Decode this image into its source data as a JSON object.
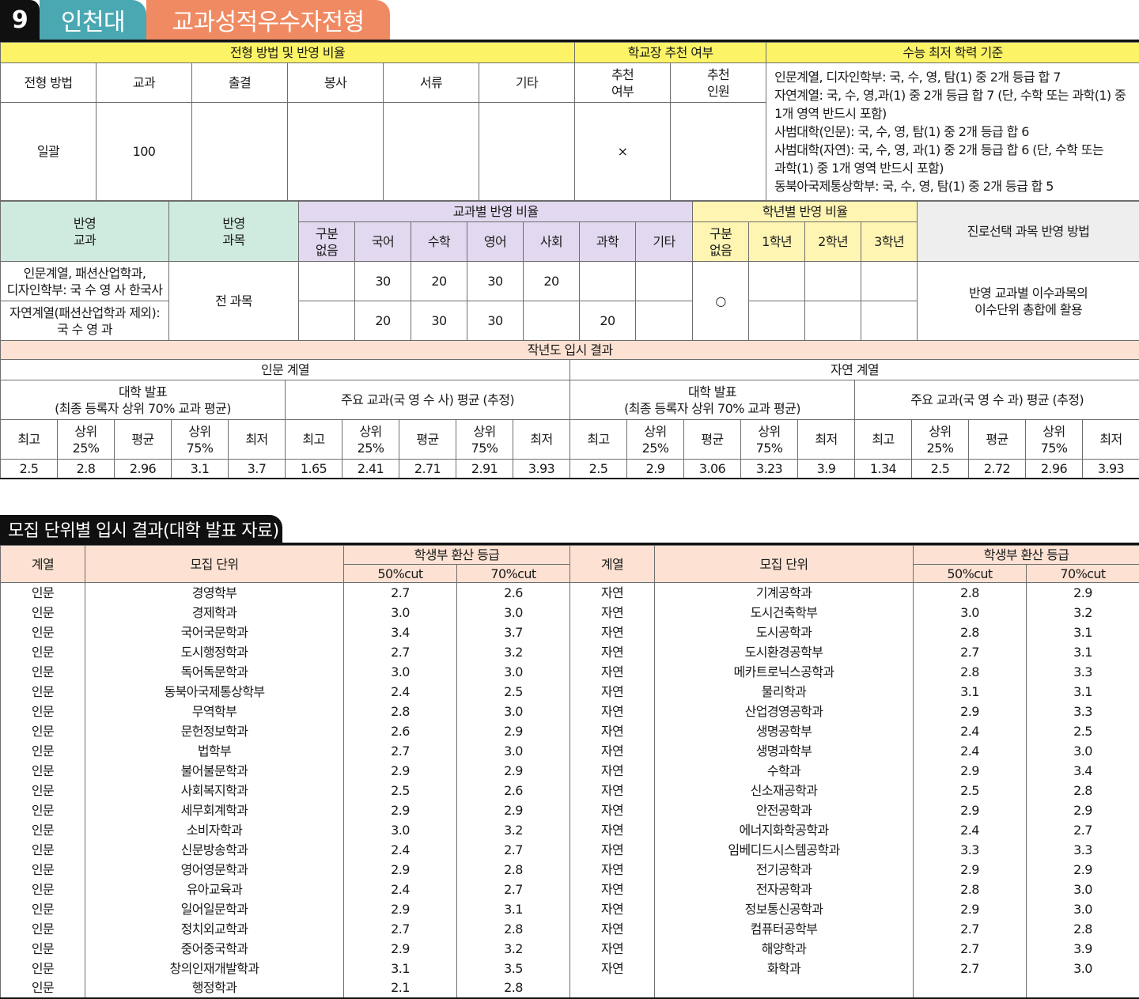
{
  "header": {
    "number": "9",
    "university": "인천대",
    "admission_type": "교과성적우수자전형"
  },
  "method_table": {
    "group_method": "전형 방법 및 반영 비율",
    "group_principal": "학교장 추천 여부",
    "group_csat": "수능 최저 학력 기준",
    "cols": [
      "전형 방법",
      "교과",
      "출결",
      "봉사",
      "서류",
      "기타"
    ],
    "principal_cols": [
      "추천\n여부",
      "추천\n인원"
    ],
    "row": [
      "일괄",
      "100",
      "",
      "",
      "",
      ""
    ],
    "principal_row": [
      "×",
      ""
    ],
    "csat_lines": [
      "인문계열, 디자인학부: 국, 수, 영, 탐(1) 중 2개 등급 합 7",
      "자연계열: 국, 수, 영,과(1) 중 2개 등급 합 7 (단, 수학 또는 과학(1) 중",
      "1개 영역 반드시 포함)",
      "사범대학(인문): 국, 수, 영, 탐(1) 중 2개 등급 합 6",
      "사범대학(자연): 국, 수, 영, 과(1) 중 2개 등급 합 6 (단, 수학 또는",
      "과학(1) 중 1개 영역 반드시 포함)",
      "동북아국제통상학부: 국, 수, 영, 탐(1) 중 2개 등급 합 5"
    ]
  },
  "reflect_table": {
    "h_subject": "반영\n교과",
    "h_courses": "반영\n과목",
    "h_subject_ratio": "교과별 반영 비율",
    "h_grade_ratio": "학년별 반영 비율",
    "h_career": "진로선택 과목 반영 방법",
    "subject_cols": [
      "구분\n없음",
      "국어",
      "수학",
      "영어",
      "사회",
      "과학",
      "기타"
    ],
    "grade_cols": [
      "구분\n없음",
      "1학년",
      "2학년",
      "3학년"
    ],
    "rows": [
      {
        "subject": "인문계열, 패션산업학과,\n디자인학부: 국 수 영 사 한국사",
        "ratios": [
          "",
          "30",
          "20",
          "30",
          "20",
          "",
          ""
        ]
      },
      {
        "subject": "자연계열(패션산업학과 제외):\n국 수 영 과",
        "ratios": [
          "",
          "20",
          "30",
          "30",
          "",
          "20",
          ""
        ]
      }
    ],
    "courses": "전 과목",
    "grade_mark": "○",
    "career_method": "반영 교과별 이수과목의\n이수단위 총합에 활용"
  },
  "last_year": {
    "title": "작년도 입시 결과",
    "humanities": "인문 계열",
    "science": "자연 계열",
    "univ_announce": "대학 발표\n(최종 등록자 상위 70% 교과 평균)",
    "main_hum": "주요 교과(국 영 수 사) 평균 (추정)",
    "main_sci": "주요 교과(국 영 수 과) 평균 (추정)",
    "stat_cols": [
      "최고",
      "상위\n25%",
      "평균",
      "상위\n75%",
      "최저"
    ],
    "values": [
      "2.5",
      "2.8",
      "2.96",
      "3.1",
      "3.7",
      "1.65",
      "2.41",
      "2.71",
      "2.91",
      "3.93",
      "2.5",
      "2.9",
      "3.06",
      "3.23",
      "3.9",
      "1.34",
      "2.5",
      "2.72",
      "2.96",
      "3.93"
    ]
  },
  "unit_results": {
    "title": "모집 단위별 입시 결과(대학 발표 자료)",
    "h_field": "계열",
    "h_unit": "모집 단위",
    "h_grade": "학생부 환산 등급",
    "h_50": "50%cut",
    "h_70": "70%cut",
    "left": [
      [
        "인문",
        "경영학부",
        "2.7",
        "2.6"
      ],
      [
        "인문",
        "경제학과",
        "3.0",
        "3.0"
      ],
      [
        "인문",
        "국어국문학과",
        "3.4",
        "3.7"
      ],
      [
        "인문",
        "도시행정학과",
        "2.7",
        "3.2"
      ],
      [
        "인문",
        "독어독문학과",
        "3.0",
        "3.0"
      ],
      [
        "인문",
        "동북아국제통상학부",
        "2.4",
        "2.5"
      ],
      [
        "인문",
        "무역학부",
        "2.8",
        "3.0"
      ],
      [
        "인문",
        "문헌정보학과",
        "2.6",
        "2.9"
      ],
      [
        "인문",
        "법학부",
        "2.7",
        "3.0"
      ],
      [
        "인문",
        "불어불문학과",
        "2.9",
        "2.9"
      ],
      [
        "인문",
        "사회복지학과",
        "2.5",
        "2.6"
      ],
      [
        "인문",
        "세무회계학과",
        "2.9",
        "2.9"
      ],
      [
        "인문",
        "소비자학과",
        "3.0",
        "3.2"
      ],
      [
        "인문",
        "신문방송학과",
        "2.4",
        "2.7"
      ],
      [
        "인문",
        "영어영문학과",
        "2.9",
        "2.8"
      ],
      [
        "인문",
        "유아교육과",
        "2.4",
        "2.7"
      ],
      [
        "인문",
        "일어일문학과",
        "2.9",
        "3.1"
      ],
      [
        "인문",
        "정치외교학과",
        "2.7",
        "2.8"
      ],
      [
        "인문",
        "중어중국학과",
        "2.9",
        "3.2"
      ],
      [
        "인문",
        "창의인재개발학과",
        "3.1",
        "3.5"
      ],
      [
        "인문",
        "행정학과",
        "2.1",
        "2.8"
      ]
    ],
    "right": [
      [
        "자연",
        "기계공학과",
        "2.8",
        "2.9"
      ],
      [
        "자연",
        "도시건축학부",
        "3.0",
        "3.2"
      ],
      [
        "자연",
        "도시공학과",
        "2.8",
        "3.1"
      ],
      [
        "자연",
        "도시환경공학부",
        "2.7",
        "3.1"
      ],
      [
        "자연",
        "메카트로닉스공학과",
        "2.8",
        "3.3"
      ],
      [
        "자연",
        "물리학과",
        "3.1",
        "3.1"
      ],
      [
        "자연",
        "산업경영공학과",
        "2.9",
        "3.3"
      ],
      [
        "자연",
        "생명공학부",
        "2.4",
        "2.5"
      ],
      [
        "자연",
        "생명과학부",
        "2.4",
        "3.0"
      ],
      [
        "자연",
        "수학과",
        "2.9",
        "3.4"
      ],
      [
        "자연",
        "신소재공학과",
        "2.5",
        "2.8"
      ],
      [
        "자연",
        "안전공학과",
        "2.9",
        "2.9"
      ],
      [
        "자연",
        "에너지화학공학과",
        "2.4",
        "2.7"
      ],
      [
        "자연",
        "임베디드시스템공학과",
        "3.3",
        "3.3"
      ],
      [
        "자연",
        "전기공학과",
        "2.9",
        "2.9"
      ],
      [
        "자연",
        "전자공학과",
        "2.8",
        "3.0"
      ],
      [
        "자연",
        "정보통신공학과",
        "2.9",
        "3.0"
      ],
      [
        "자연",
        "컴퓨터공학부",
        "2.7",
        "2.8"
      ],
      [
        "자연",
        "해양학과",
        "2.7",
        "3.9"
      ],
      [
        "자연",
        "화학과",
        "2.7",
        "3.0"
      ],
      [
        "",
        "",
        "",
        ""
      ]
    ]
  }
}
